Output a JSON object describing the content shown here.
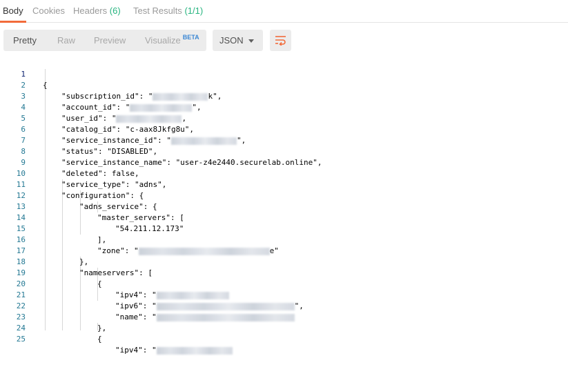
{
  "tabs": [
    {
      "label": "Body",
      "count": ""
    },
    {
      "label": "Cookies",
      "count": ""
    },
    {
      "label": "Headers",
      "count": "(6)"
    },
    {
      "label": "Test Results",
      "count": "(1/1)"
    }
  ],
  "toolbar": {
    "view_modes": [
      "Pretty",
      "Raw",
      "Preview",
      "Visualize"
    ],
    "beta_badge": "BETA",
    "format": "JSON",
    "wrap_icon": "wrap-lines-icon"
  },
  "code": {
    "line_numbers": [
      "1",
      "2",
      "3",
      "4",
      "5",
      "6",
      "7",
      "8",
      "9",
      "10",
      "11",
      "12",
      "13",
      "14",
      "15",
      "16",
      "17",
      "18",
      "19",
      "20",
      "21",
      "22",
      "23",
      "24",
      "25"
    ],
    "lines": {
      "l1": "{",
      "l2_key": "\"subscription_id\": \"",
      "l2_end": "k\",",
      "l3_key": "\"account_id\": \"",
      "l3_end": "\",",
      "l4_key": "\"user_id\": \"",
      "l4_end": ",",
      "l5": "\"catalog_id\": \"c-aax8Jkfg8u\",",
      "l6_key": "\"service_instance_id\": \"",
      "l6_end": "\",",
      "l7": "\"status\": \"DISABLED\",",
      "l8": "\"service_instance_name\": \"user-z4e2440.securelab.online\",",
      "l9": "\"deleted\": false,",
      "l10": "\"service_type\": \"adns\",",
      "l11": "\"configuration\": {",
      "l12": "\"adns_service\": {",
      "l13": "\"master_servers\": [",
      "l14": "\"54.211.12.173\"",
      "l15": "],",
      "l16_key": "\"zone\": \"",
      "l16_end": "e\"",
      "l17": "},",
      "l18": "\"nameservers\": [",
      "l19": "{",
      "l20_key": "\"ipv4\": \"",
      "l21_key": "\"ipv6\": \"",
      "l21_end": "\",",
      "l22_key": "\"name\": \"",
      "l23": "},",
      "l24": "{",
      "l25_key": "\"ipv4\": \""
    }
  },
  "colors": {
    "accent": "#f26b3a",
    "count_green": "#26b47f",
    "beta_blue": "#3b87d3",
    "line_number": "#237893"
  }
}
